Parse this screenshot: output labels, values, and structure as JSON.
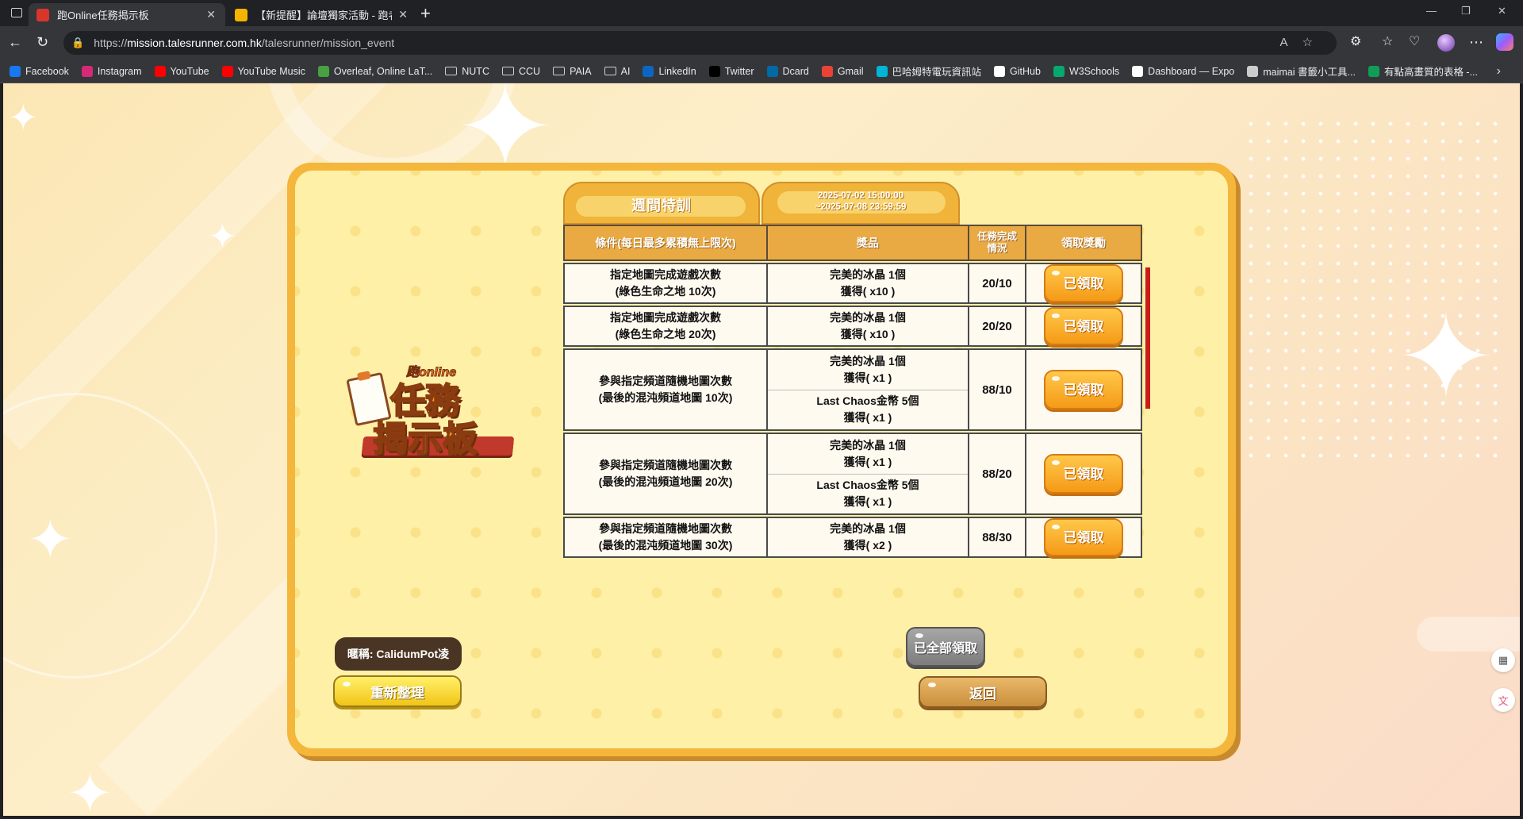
{
  "browser": {
    "tabs": [
      {
        "title": "跑Online任務揭示板",
        "active": true,
        "favicon_color": "#d9352b"
      },
      {
        "title": "【新提醒】論壇獨家活動 - 跑者的",
        "active": false,
        "favicon_color": "#f5b400"
      }
    ],
    "url_scheme": "https://",
    "url_host": "mission.talesrunner.com.hk",
    "url_path": "/talesrunner/mission_event",
    "bookmarks": [
      {
        "label": "Facebook",
        "icon": "facebook-icon",
        "color": "#1877f2"
      },
      {
        "label": "Instagram",
        "icon": "instagram-icon",
        "color": "#d62976"
      },
      {
        "label": "YouTube",
        "icon": "youtube-icon",
        "color": "#ff0000"
      },
      {
        "label": "YouTube Music",
        "icon": "youtube-music-icon",
        "color": "#ff0000"
      },
      {
        "label": "Overleaf, Online LaT...",
        "icon": "overleaf-icon",
        "color": "#47a141"
      },
      {
        "label": "NUTC",
        "icon": "folder-icon"
      },
      {
        "label": "CCU",
        "icon": "folder-icon"
      },
      {
        "label": "PAIA",
        "icon": "folder-icon"
      },
      {
        "label": "AI",
        "icon": "folder-icon"
      },
      {
        "label": "LinkedIn",
        "icon": "linkedin-icon",
        "color": "#0a66c2"
      },
      {
        "label": "Twitter",
        "icon": "x-icon",
        "color": "#000000"
      },
      {
        "label": "Dcard",
        "icon": "dcard-icon",
        "color": "#006aa6"
      },
      {
        "label": "Gmail",
        "icon": "gmail-icon",
        "color": "#ea4335"
      },
      {
        "label": "巴哈姆特電玩資訊站",
        "icon": "bahamut-icon",
        "color": "#00b4d8"
      },
      {
        "label": "GitHub",
        "icon": "github-icon",
        "color": "#ffffff"
      },
      {
        "label": "W3Schools",
        "icon": "w3schools-icon",
        "color": "#04aa6d"
      },
      {
        "label": "Dashboard — Expo",
        "icon": "expo-icon",
        "color": "#ffffff"
      },
      {
        "label": "maimai 書籤小工具...",
        "icon": "globe-icon",
        "color": "#cccccc"
      },
      {
        "label": "有點高畫質的表格 -...",
        "icon": "sheets-icon",
        "color": "#0f9d58"
      }
    ]
  },
  "mission": {
    "tab_title": "週間特訓",
    "date_start": "2025-07-02 15:00:00",
    "date_end": "~2025-07-08 23:59:59",
    "headers": [
      "條件(每日最多累積無上限次)",
      "獎品",
      "任務完成情況",
      "領取獎勵"
    ],
    "rows": [
      {
        "condition": [
          "指定地圖完成遊戲次數",
          "(綠色生命之地 10次)"
        ],
        "rewards": [
          [
            "完美的冰晶 1個",
            "獲得( x10 )"
          ]
        ],
        "progress": "20/10",
        "button": "已領取"
      },
      {
        "condition": [
          "指定地圖完成遊戲次數",
          "(綠色生命之地 20次)"
        ],
        "rewards": [
          [
            "完美的冰晶 1個",
            "獲得( x10 )"
          ]
        ],
        "progress": "20/20",
        "button": "已領取"
      },
      {
        "condition": [
          "參與指定頻道隨機地圖次數",
          "(最後的混沌頻道地圖 10次)"
        ],
        "rewards": [
          [
            "完美的冰晶 1個",
            "獲得( x1 )"
          ],
          [
            "Last Chaos金幣 5個",
            "獲得( x1 )"
          ]
        ],
        "progress": "88/10",
        "button": "已領取"
      },
      {
        "condition": [
          "參與指定頻道隨機地圖次數",
          "(最後的混沌頻道地圖 20次)"
        ],
        "rewards": [
          [
            "完美的冰晶 1個",
            "獲得( x1 )"
          ],
          [
            "Last Chaos金幣 5個",
            "獲得( x1 )"
          ]
        ],
        "progress": "88/20",
        "button": "已領取"
      },
      {
        "condition": [
          "參與指定頻道隨機地圖次數",
          "(最後的混沌頻道地圖 30次)"
        ],
        "rewards": [
          [
            "完美的冰晶 1個",
            "獲得( x2 )"
          ]
        ],
        "progress": "88/30",
        "button": "已領取"
      }
    ],
    "nickname": "暱稱: CalidumPot凌",
    "refresh_label": "重新整理",
    "claim_all_label": "已全部領取",
    "back_label": "返回",
    "logo_small": "跑online",
    "logo_line1": "任務",
    "logo_line2": "揭示板"
  }
}
